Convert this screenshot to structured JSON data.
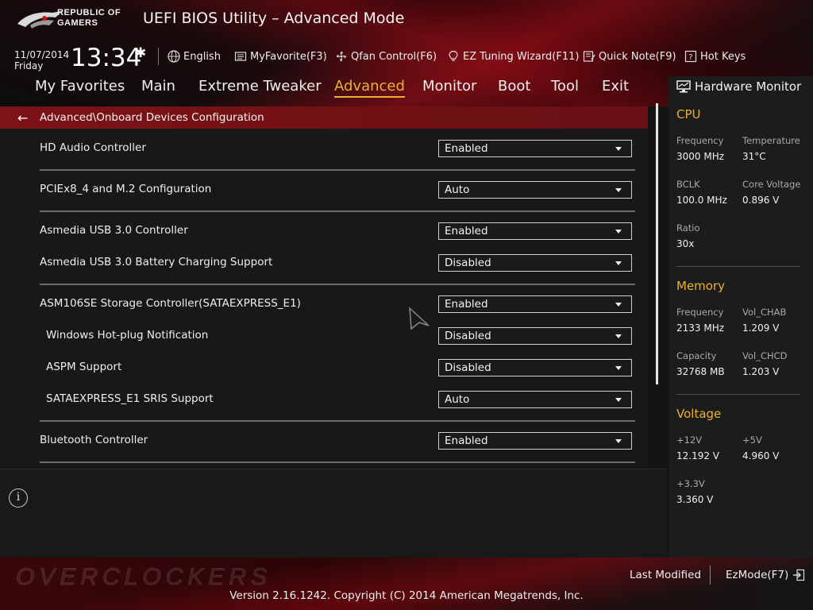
{
  "header": {
    "logo_line1": "REPUBLIC OF",
    "logo_line2": "GAMERS",
    "title": "UEFI BIOS Utility – Advanced Mode",
    "date": "11/07/2014",
    "day": "Friday",
    "time": "13:34",
    "tools": {
      "language": "English",
      "myfavorite": "MyFavorite(F3)",
      "qfan": "Qfan Control(F6)",
      "ez_tuning": "EZ Tuning Wizard(F11)",
      "quick_note": "Quick Note(F9)",
      "hot_keys": "Hot Keys"
    }
  },
  "menu": {
    "items": [
      "My Favorites",
      "Main",
      "Extreme Tweaker",
      "Advanced",
      "Monitor",
      "Boot",
      "Tool",
      "Exit"
    ],
    "active": "Advanced"
  },
  "breadcrumb": "Advanced\\Onboard Devices Configuration",
  "settings": [
    {
      "label": "HD Audio Controller",
      "value": "Enabled"
    },
    {
      "label": "PCIEx8_4 and M.2 Configuration",
      "value": "Auto"
    },
    {
      "label": "Asmedia USB 3.0 Controller",
      "value": "Enabled"
    },
    {
      "label": "Asmedia USB 3.0 Battery Charging Support",
      "value": "Disabled"
    },
    {
      "label": "ASM106SE Storage Controller(SATAEXPRESS_E1)",
      "value": "Enabled"
    },
    {
      "label": "Windows Hot-plug Notification",
      "value": "Disabled"
    },
    {
      "label": "ASPM Support",
      "value": "Disabled"
    },
    {
      "label": "SATAEXPRESS_E1 SRIS Support",
      "value": "Auto"
    },
    {
      "label": "Bluetooth Controller",
      "value": "Enabled"
    }
  ],
  "hardware_monitor": {
    "title": "Hardware Monitor",
    "cpu": {
      "heading": "CPU",
      "frequency_label": "Frequency",
      "frequency": "3000 MHz",
      "temperature_label": "Temperature",
      "temperature": "31°C",
      "bclk_label": "BCLK",
      "bclk": "100.0 MHz",
      "core_voltage_label": "Core Voltage",
      "core_voltage": "0.896 V",
      "ratio_label": "Ratio",
      "ratio": "30x"
    },
    "memory": {
      "heading": "Memory",
      "frequency_label": "Frequency",
      "frequency": "2133 MHz",
      "vol_chab_label": "Vol_CHAB",
      "vol_chab": "1.209 V",
      "capacity_label": "Capacity",
      "capacity": "32768 MB",
      "vol_chcd_label": "Vol_CHCD",
      "vol_chcd": "1.203 V"
    },
    "voltage": {
      "heading": "Voltage",
      "v12_label": "+12V",
      "v12": "12.192 V",
      "v5_label": "+5V",
      "v5": "4.960 V",
      "v33_label": "+3.3V",
      "v33": "3.360 V"
    }
  },
  "footer": {
    "watermark": "OVERCLOCKERS",
    "last_modified": "Last Modified",
    "ezmode": "EzMode(F7)",
    "version": "Version 2.16.1242. Copyright (C) 2014 American Megatrends, Inc."
  },
  "colors": {
    "accent": "#e8b332",
    "breadcrumb_bg": "#7c1316",
    "background": "#141414"
  }
}
